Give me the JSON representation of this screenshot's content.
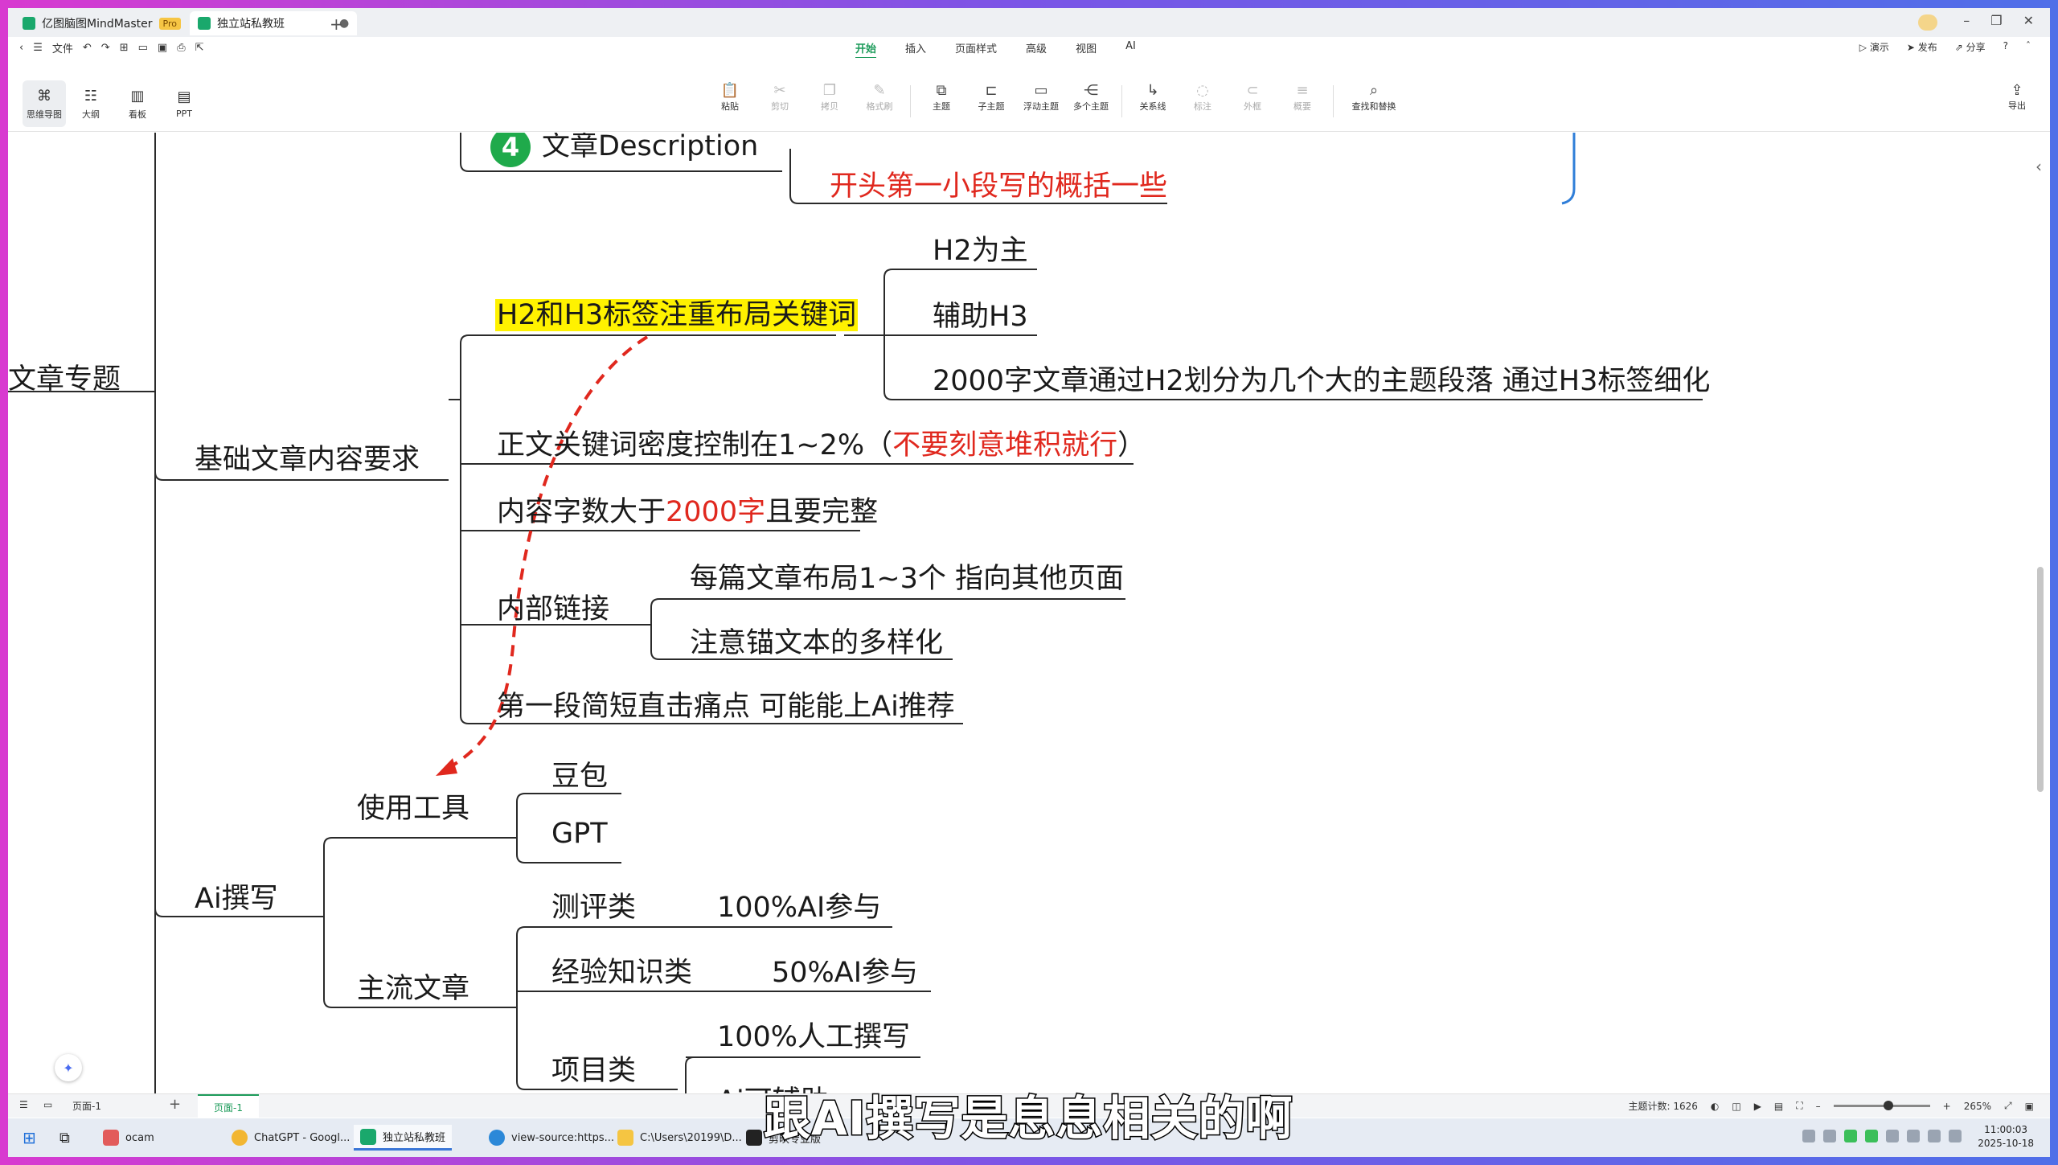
{
  "titlebar": {
    "tab1_label": "亿图脑图MindMaster",
    "tab1_badge": "Pro",
    "tab2_label": "独立站私教班",
    "tab2_close": "●"
  },
  "menurow": {
    "file_label": "文件",
    "tabs": [
      "开始",
      "插入",
      "页面样式",
      "高级",
      "视图",
      "AI"
    ],
    "right": [
      "演示",
      "发布",
      "分享"
    ]
  },
  "toolbar": {
    "views": [
      "思维导图",
      "大纲",
      "看板",
      "PPT"
    ],
    "tools": [
      "粘贴",
      "剪切",
      "拷贝",
      "格式刷",
      "主题",
      "子主题",
      "浮动主题",
      "多个主题",
      "关系线",
      "标注",
      "外框",
      "概要",
      "查找和替换"
    ],
    "export_label": "导出"
  },
  "mindmap": {
    "root_partial": "文章专题",
    "desc_title": "文章Description",
    "desc_badge": "4",
    "desc_child": "开头第一小段写的概括一些",
    "basic": {
      "label": "基础文章内容要求",
      "h2h3": "H2和H3标签注重布局关键词",
      "h2_main": "H2为主",
      "h3_aux": "辅助H3",
      "h2_detail": "2000字文章通过H2划分为几个大的主题段落 通过H3标签细化",
      "density_prefix": "正文关键词密度控制在1~2%（",
      "density_red": "不要刻意堆积就行",
      "density_suffix": "）",
      "count_prefix": "内容字数大于",
      "count_red": "2000字",
      "count_suffix": "且要完整",
      "links": "内部链接",
      "links_1": "每篇文章布局1~3个 指向其他页面",
      "links_2": "注意锚文本的多样化",
      "first_para": "第一段简短直击痛点  可能能上Ai推荐"
    },
    "ai": {
      "label": "Ai撰写",
      "tools": "使用工具",
      "doubao": "豆包",
      "gpt": "GPT",
      "mainstream": "主流文章",
      "review": "测评类",
      "review_pct": "100%AI参与",
      "exp": "经验知识类",
      "exp_pct": "50%AI参与",
      "project": "项目类",
      "project_1": "100%人工撰写",
      "project_2": "Ai可辅助"
    }
  },
  "statusbar": {
    "page_select": "页面-1",
    "page_tab": "页面-1",
    "topic_count_label": "主题计数:",
    "topic_count": "1626",
    "zoom": "265%"
  },
  "taskbar": {
    "items": [
      "ocam",
      "ChatGPT - Googl...",
      "独立站私教班",
      "view-source:https...",
      "C:\\Users\\20199\\D...",
      "剪映专业版"
    ],
    "time": "11:00:03",
    "date": "2025-10-18"
  },
  "subtitle": "跟AI撰写是息息相关的啊",
  "colors": {
    "accent": "#1c9b5a",
    "red_text": "#e0281e",
    "highlight": "#fff200",
    "relation_line": "#e0281e"
  }
}
